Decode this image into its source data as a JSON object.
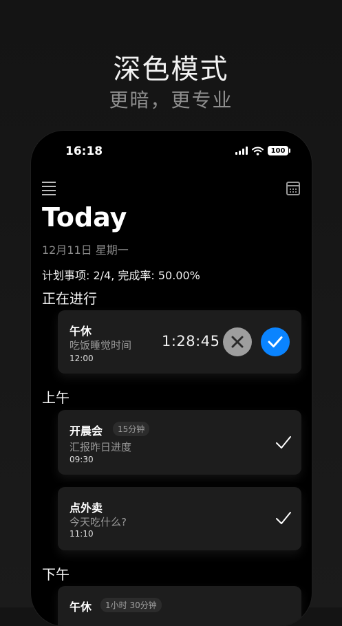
{
  "promo": {
    "title": "深色模式",
    "subtitle": "更暗，更专业"
  },
  "status_bar": {
    "time": "16:18",
    "battery": "100"
  },
  "header": {
    "title": "Today",
    "date": "12月11日 星期一",
    "stats": "计划事项: 2/4, 完成率: 50.00%"
  },
  "sections": {
    "in_progress": "正在进行",
    "morning": "上午",
    "afternoon": "下午"
  },
  "current_task": {
    "title": "午休",
    "description": "吃饭睡觉时间",
    "time": "12:00",
    "timer": "1:28:45"
  },
  "morning_tasks": [
    {
      "title": "开晨会",
      "badge": "15分钟",
      "description": "汇报昨日进度",
      "time": "09:30"
    },
    {
      "title": "点外卖",
      "description": "今天吃什么?",
      "time": "11:10"
    }
  ],
  "afternoon_tasks": [
    {
      "title": "午休",
      "badge": "1小时 30分钟"
    }
  ],
  "colors": {
    "accent": "#0a84ff",
    "cancel": "#9e9e9e",
    "card": "#1d1d1d"
  }
}
